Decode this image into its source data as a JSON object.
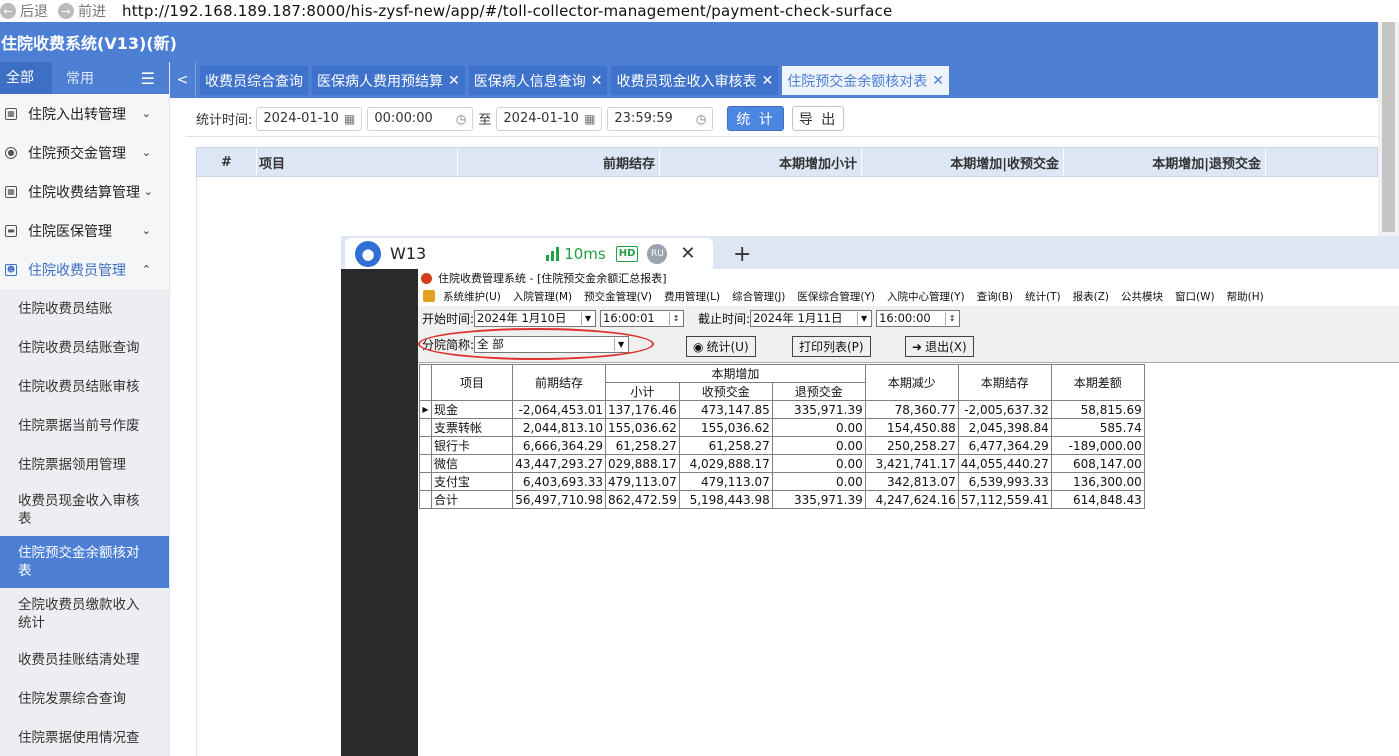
{
  "browser": {
    "back_label": "后退",
    "forward_label": "前进",
    "url": "http://192.168.189.187:8000/his-zysf-new/app/#/toll-collector-management/payment-check-surface"
  },
  "app": {
    "title": "住院收费系统(V13)(新)"
  },
  "sidebar": {
    "tab_all": "全部",
    "tab_common": "常用",
    "groups": [
      {
        "label": "住院入出转管理"
      },
      {
        "label": "住院预交金管理"
      },
      {
        "label": "住院收费结算管理"
      },
      {
        "label": "住院医保管理"
      },
      {
        "label": "住院收费员管理"
      }
    ],
    "items": [
      {
        "label": "住院收费员结账"
      },
      {
        "label": "住院收费员结账查询"
      },
      {
        "label": "住院收费员结账审核"
      },
      {
        "label": "住院票据当前号作废"
      },
      {
        "label": "住院票据领用管理"
      },
      {
        "label": "收费员现金收入审核表"
      },
      {
        "label": "住院预交金余额核对表"
      },
      {
        "label": "全院收费员缴款收入统计"
      },
      {
        "label": "收费员挂账结清处理"
      },
      {
        "label": "住院发票综合查询"
      },
      {
        "label": "住院票据使用情况查"
      }
    ]
  },
  "tabs": [
    {
      "label": "收费员综合查询"
    },
    {
      "label": "医保病人费用预结算"
    },
    {
      "label": "医保病人信息查询"
    },
    {
      "label": "收费员现金收入审核表"
    },
    {
      "label": "住院预交金余额核对表"
    }
  ],
  "filter": {
    "label": "统计时间:",
    "start_date": "2024-01-10",
    "start_time": "00:00:00",
    "to": "至",
    "end_date": "2024-01-10",
    "end_time": "23:59:59",
    "stat_button": "统 计",
    "export_button": "导 出"
  },
  "grid": {
    "columns": [
      "#",
      "项目",
      "前期结存",
      "本期增加小计",
      "本期增加|收预交金",
      "本期增加|退预交金"
    ]
  },
  "remote": {
    "tab_name": "W13",
    "latency": "10ms",
    "hd": "HD",
    "ru": "RU",
    "legacy": {
      "title": "住院收费管理系统 - [住院预交金余额汇总报表]",
      "menus": [
        "系统维护(U)",
        "入院管理(M)",
        "预交金管理(V)",
        "费用管理(L)",
        "综合管理(J)",
        "医保综合管理(Y)",
        "入院中心管理(Y)",
        "查询(B)",
        "统计(T)",
        "报表(Z)",
        "公共模块",
        "窗口(W)",
        "帮助(H)"
      ],
      "start_label": "开始时间:",
      "start_date": "2024年 1月10日",
      "start_time": "16:00:01",
      "end_label": "截止时间:",
      "end_date": "2024年 1月11日",
      "end_time": "16:00:00",
      "branch_label": "分院简称:",
      "branch_value": "全 部",
      "btn_stat": "统计(U)",
      "btn_print": "打印列表(P)",
      "btn_exit": "退出(X)",
      "headers": {
        "item": "项目",
        "prev": "前期结存",
        "increase": "本期增加",
        "subtotal": "小计",
        "receive": "收预交金",
        "refund": "退预交金",
        "decrease": "本期减少",
        "balance": "本期结存",
        "diff": "本期差额"
      },
      "rows": [
        {
          "item": "现金",
          "prev": "-2,064,453.01",
          "subtotal": "137,176.46",
          "receive": "473,147.85",
          "refund": "335,971.39",
          "decrease": "78,360.77",
          "balance": "-2,005,637.32",
          "diff": "58,815.69"
        },
        {
          "item": "支票转帐",
          "prev": "2,044,813.10",
          "subtotal": "155,036.62",
          "receive": "155,036.62",
          "refund": "0.00",
          "decrease": "154,450.88",
          "balance": "2,045,398.84",
          "diff": "585.74"
        },
        {
          "item": "银行卡",
          "prev": "6,666,364.29",
          "subtotal": "61,258.27",
          "receive": "61,258.27",
          "refund": "0.00",
          "decrease": "250,258.27",
          "balance": "6,477,364.29",
          "diff": "-189,000.00"
        },
        {
          "item": "微信",
          "prev": "43,447,293.27",
          "subtotal": "029,888.17",
          "receive": "4,029,888.17",
          "refund": "0.00",
          "decrease": "3,421,741.17",
          "balance": "44,055,440.27",
          "diff": "608,147.00"
        },
        {
          "item": "支付宝",
          "prev": "6,403,693.33",
          "subtotal": "479,113.07",
          "receive": "479,113.07",
          "refund": "0.00",
          "decrease": "342,813.07",
          "balance": "6,539,993.33",
          "diff": "136,300.00"
        },
        {
          "item": "合计",
          "prev": "56,497,710.98",
          "subtotal": "862,472.59",
          "receive": "5,198,443.98",
          "refund": "335,971.39",
          "decrease": "4,247,624.16",
          "balance": "57,112,559.41",
          "diff": "614,848.43"
        }
      ]
    }
  },
  "colors": {
    "primary": "#4d7fd4",
    "active_tab_text": "#4d7fd4",
    "highlight_oval": "#e03030"
  }
}
